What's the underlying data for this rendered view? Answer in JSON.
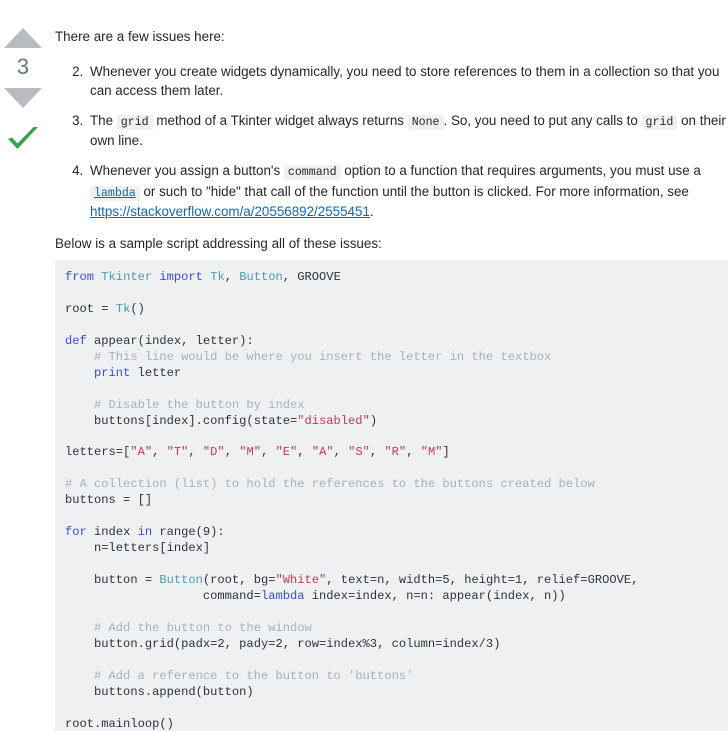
{
  "vote": {
    "upvote_icon": "triangle-up-icon",
    "downvote_icon": "triangle-down-icon",
    "count": "3",
    "accepted_icon": "checkmark-icon",
    "arrow_color": "#b6bcc0",
    "count_color": "#6a737c",
    "accepted_color": "#3d9e5a"
  },
  "answer": {
    "intro": "There are a few issues here:",
    "list": [
      {
        "number": "2.",
        "parts": [
          {
            "type": "text",
            "value": "Whenever you create widgets dynamically, you need to store references to them in a collection so that you can access them later."
          }
        ]
      },
      {
        "number": "3.",
        "parts": [
          {
            "type": "text",
            "value": "The "
          },
          {
            "type": "code",
            "value": "grid"
          },
          {
            "type": "text",
            "value": " method of a Tkinter widget always returns "
          },
          {
            "type": "code",
            "value": "None"
          },
          {
            "type": "text",
            "value": ". So, you need to put any calls to "
          },
          {
            "type": "code",
            "value": "grid"
          },
          {
            "type": "text",
            "value": " on their own line."
          }
        ]
      },
      {
        "number": "4.",
        "parts": [
          {
            "type": "text",
            "value": "Whenever you assign a button's "
          },
          {
            "type": "code",
            "value": "command"
          },
          {
            "type": "text",
            "value": " option to a function that requires arguments, you must use a "
          },
          {
            "type": "code-link",
            "value": "lambda"
          },
          {
            "type": "text",
            "value": " or such to \"hide\" that call of the function until the button is clicked. For more information, see "
          },
          {
            "type": "link",
            "value": "https://stackoverflow.com/a/20556892/2555451"
          },
          {
            "type": "text",
            "value": "."
          }
        ]
      }
    ],
    "sample_intro": "Below is a sample script addressing all of these issues:"
  },
  "code": {
    "language": "python",
    "background": "#eff0f1",
    "colors": {
      "keyword": "#3b4ed0",
      "class": "#4b9cb0",
      "string": "#c23b52",
      "comment": "#a9b0b6",
      "plain": "#2f3337"
    },
    "lines": [
      [
        {
          "t": "k",
          "v": "from"
        },
        {
          "t": "nb",
          "v": " "
        },
        {
          "t": "cls",
          "v": "Tkinter"
        },
        {
          "t": "nb",
          "v": " "
        },
        {
          "t": "k",
          "v": "import"
        },
        {
          "t": "nb",
          "v": " "
        },
        {
          "t": "cls",
          "v": "Tk"
        },
        {
          "t": "nb",
          "v": ", "
        },
        {
          "t": "cls",
          "v": "Button"
        },
        {
          "t": "nb",
          "v": ", GROOVE"
        }
      ],
      [],
      [
        {
          "t": "nb",
          "v": "root = "
        },
        {
          "t": "cls",
          "v": "Tk"
        },
        {
          "t": "nb",
          "v": "()"
        }
      ],
      [],
      [
        {
          "t": "k",
          "v": "def"
        },
        {
          "t": "nb",
          "v": " appear(index, letter):"
        }
      ],
      [
        {
          "t": "cm",
          "v": "    # This line would be where you insert the letter in the textbox"
        }
      ],
      [
        {
          "t": "nb",
          "v": "    "
        },
        {
          "t": "k",
          "v": "print"
        },
        {
          "t": "nb",
          "v": " letter"
        }
      ],
      [],
      [
        {
          "t": "cm",
          "v": "    # Disable the button by index"
        }
      ],
      [
        {
          "t": "nb",
          "v": "    buttons[index].config(state="
        },
        {
          "t": "s",
          "v": "\"disabled\""
        },
        {
          "t": "nb",
          "v": ")"
        }
      ],
      [],
      [
        {
          "t": "nb",
          "v": "letters=["
        },
        {
          "t": "s",
          "v": "\"A\""
        },
        {
          "t": "nb",
          "v": ", "
        },
        {
          "t": "s",
          "v": "\"T\""
        },
        {
          "t": "nb",
          "v": ", "
        },
        {
          "t": "s",
          "v": "\"D\""
        },
        {
          "t": "nb",
          "v": ", "
        },
        {
          "t": "s",
          "v": "\"M\""
        },
        {
          "t": "nb",
          "v": ", "
        },
        {
          "t": "s",
          "v": "\"E\""
        },
        {
          "t": "nb",
          "v": ", "
        },
        {
          "t": "s",
          "v": "\"A\""
        },
        {
          "t": "nb",
          "v": ", "
        },
        {
          "t": "s",
          "v": "\"S\""
        },
        {
          "t": "nb",
          "v": ", "
        },
        {
          "t": "s",
          "v": "\"R\""
        },
        {
          "t": "nb",
          "v": ", "
        },
        {
          "t": "s",
          "v": "\"M\""
        },
        {
          "t": "nb",
          "v": "]"
        }
      ],
      [],
      [
        {
          "t": "cm",
          "v": "# A collection (list) to hold the references to the buttons created below"
        }
      ],
      [
        {
          "t": "nb",
          "v": "buttons = []"
        }
      ],
      [],
      [
        {
          "t": "k",
          "v": "for"
        },
        {
          "t": "nb",
          "v": " index "
        },
        {
          "t": "k",
          "v": "in"
        },
        {
          "t": "nb",
          "v": " range(9):"
        }
      ],
      [
        {
          "t": "nb",
          "v": "    n=letters[index]"
        }
      ],
      [],
      [
        {
          "t": "nb",
          "v": "    button = "
        },
        {
          "t": "cls",
          "v": "Button"
        },
        {
          "t": "nb",
          "v": "(root, bg="
        },
        {
          "t": "s",
          "v": "\"White\""
        },
        {
          "t": "nb",
          "v": ", text=n, width=5, height=1, relief=GROOVE,"
        }
      ],
      [
        {
          "t": "nb",
          "v": "                   command="
        },
        {
          "t": "k",
          "v": "lambda"
        },
        {
          "t": "nb",
          "v": " index=index, n=n: appear(index, n))"
        }
      ],
      [],
      [
        {
          "t": "cm",
          "v": "    # Add the button to the window"
        }
      ],
      [
        {
          "t": "nb",
          "v": "    button.grid(padx=2, pady=2, row=index%3, column=index/3)"
        }
      ],
      [],
      [
        {
          "t": "cm",
          "v": "    # Add a reference to the button to 'buttons'"
        }
      ],
      [
        {
          "t": "nb",
          "v": "    buttons.append(button)"
        }
      ],
      [],
      [
        {
          "t": "nb",
          "v": "root.mainloop()"
        }
      ]
    ]
  }
}
